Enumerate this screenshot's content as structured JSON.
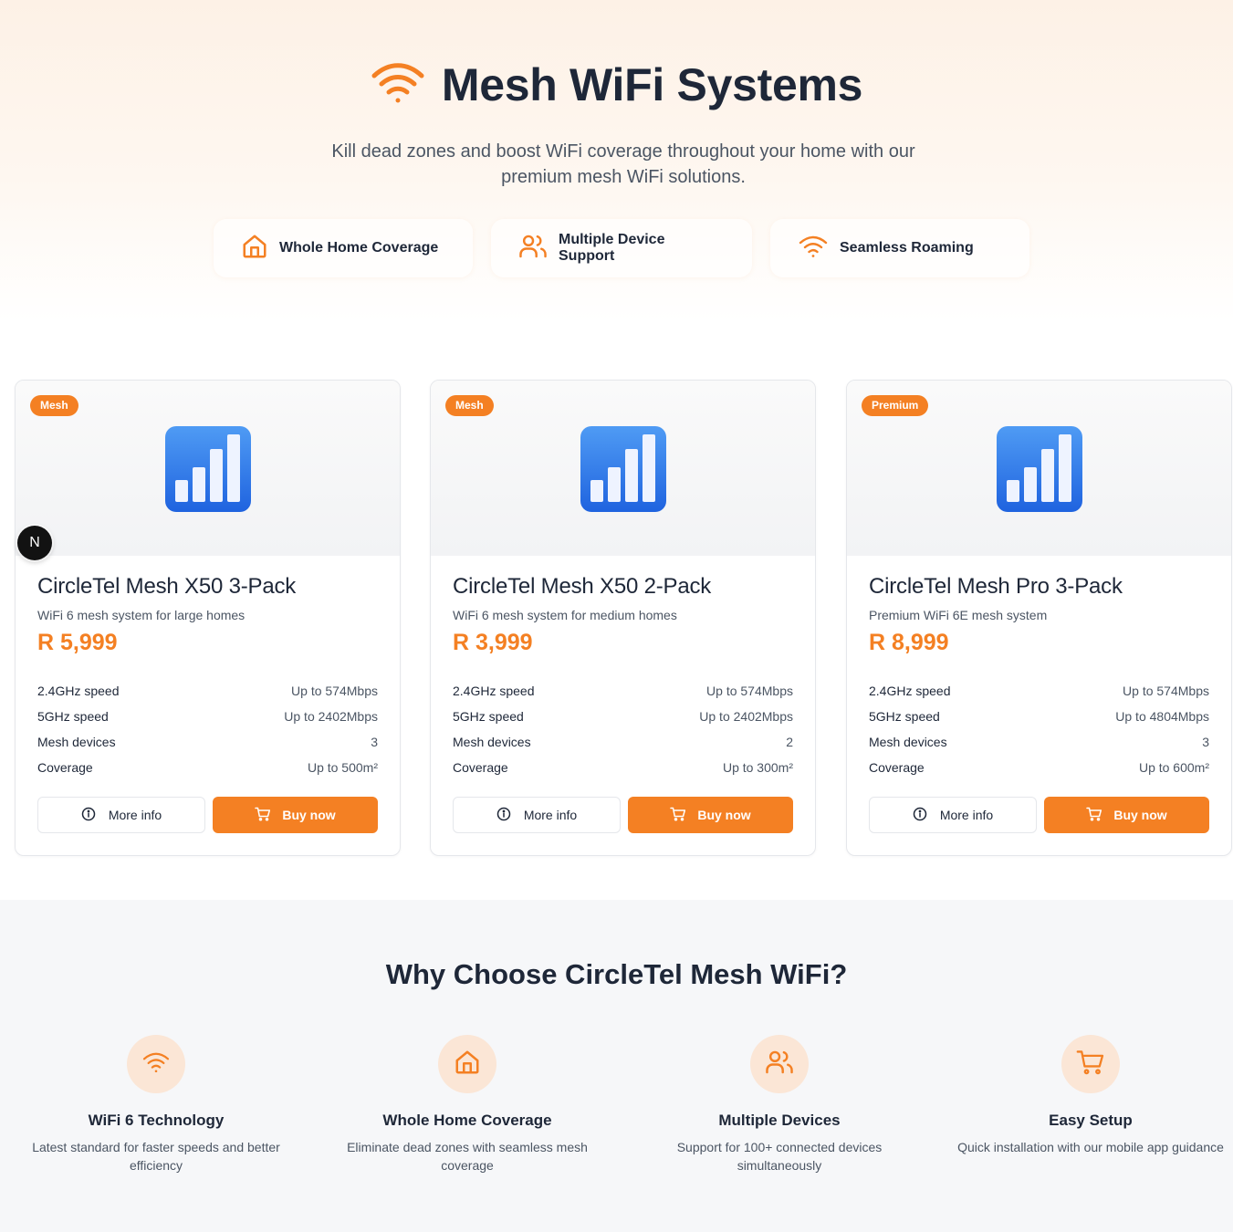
{
  "hero": {
    "title": "Mesh WiFi Systems",
    "subtitle": "Kill dead zones and boost WiFi coverage throughout your home with our premium mesh WiFi solutions.",
    "title_icon": "wifi-icon",
    "highlights": [
      {
        "label": "Whole Home Coverage",
        "icon": "home-icon"
      },
      {
        "label": "Multiple Device Support",
        "icon": "users-icon"
      },
      {
        "label": "Seamless Roaming",
        "icon": "wifi-icon"
      }
    ]
  },
  "products": [
    {
      "badge": "Mesh",
      "name": "CircleTel Mesh X50 3-Pack",
      "description": "WiFi 6 mesh system for large homes",
      "price": "R 5,999",
      "specs": [
        {
          "key": "2.4GHz speed",
          "value": "Up to 574Mbps"
        },
        {
          "key": "5GHz speed",
          "value": "Up to 2402Mbps"
        },
        {
          "key": "Mesh devices",
          "value": "3"
        },
        {
          "key": "Coverage",
          "value": "Up to 500m²"
        }
      ],
      "more_label": "More info",
      "buy_label": "Buy now"
    },
    {
      "badge": "Mesh",
      "name": "CircleTel Mesh X50 2-Pack",
      "description": "WiFi 6 mesh system for medium homes",
      "price": "R 3,999",
      "specs": [
        {
          "key": "2.4GHz speed",
          "value": "Up to 574Mbps"
        },
        {
          "key": "5GHz speed",
          "value": "Up to 2402Mbps"
        },
        {
          "key": "Mesh devices",
          "value": "2"
        },
        {
          "key": "Coverage",
          "value": "Up to 300m²"
        }
      ],
      "more_label": "More info",
      "buy_label": "Buy now"
    },
    {
      "badge": "Premium",
      "name": "CircleTel Mesh Pro 3-Pack",
      "description": "Premium WiFi 6E mesh system",
      "price": "R 8,999",
      "specs": [
        {
          "key": "2.4GHz speed",
          "value": "Up to 574Mbps"
        },
        {
          "key": "5GHz speed",
          "value": "Up to 4804Mbps"
        },
        {
          "key": "Mesh devices",
          "value": "3"
        },
        {
          "key": "Coverage",
          "value": "Up to 600m²"
        }
      ],
      "more_label": "More info",
      "buy_label": "Buy now"
    }
  ],
  "why": {
    "title": "Why Choose CircleTel Mesh WiFi?",
    "features": [
      {
        "title": "WiFi 6 Technology",
        "text": "Latest standard for faster speeds and better efficiency",
        "icon": "wifi-icon"
      },
      {
        "title": "Whole Home Coverage",
        "text": "Eliminate dead zones with seamless mesh coverage",
        "icon": "home-icon"
      },
      {
        "title": "Multiple Devices",
        "text": "Support for 100+ connected devices simultaneously",
        "icon": "users-icon"
      },
      {
        "title": "Easy Setup",
        "text": "Quick installation with our mobile app guidance",
        "icon": "cart-icon"
      }
    ]
  },
  "dev_badge": "N",
  "colors": {
    "accent": "#f48023",
    "heading": "#1e2738",
    "body": "#4b5563"
  }
}
